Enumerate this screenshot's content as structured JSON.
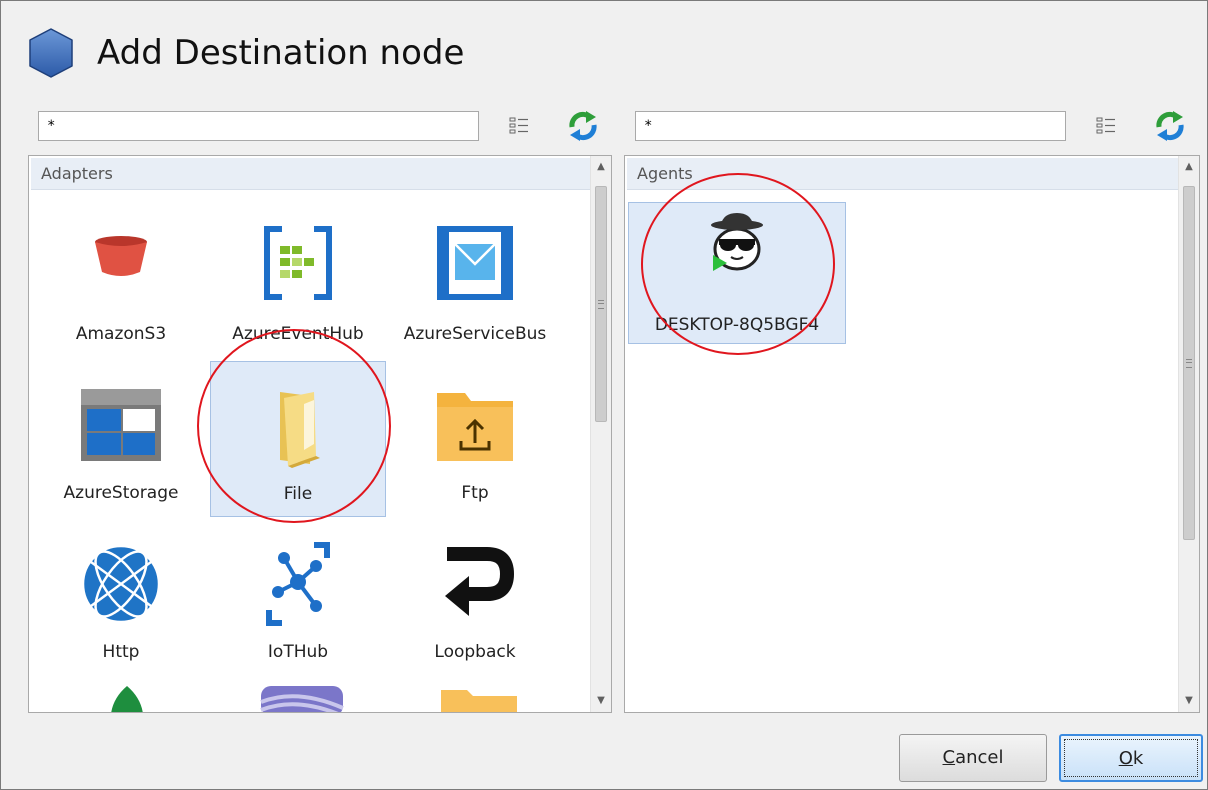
{
  "window": {
    "title": "Add Destination node"
  },
  "left": {
    "search_value": "*",
    "group_header": "Adapters",
    "items": [
      {
        "label": "AmazonS3",
        "icon": "amazon-s3-icon"
      },
      {
        "label": "AzureEventHub",
        "icon": "azure-event-hub-icon"
      },
      {
        "label": "AzureServiceBus",
        "icon": "azure-service-bus-icon"
      },
      {
        "label": "AzureStorage",
        "icon": "azure-storage-icon"
      },
      {
        "label": "File",
        "icon": "folder-icon",
        "selected": true
      },
      {
        "label": "Ftp",
        "icon": "ftp-upload-icon"
      },
      {
        "label": "Http",
        "icon": "globe-icon"
      },
      {
        "label": "IoTHub",
        "icon": "iot-hub-icon"
      },
      {
        "label": "Loopback",
        "icon": "loopback-arrow-icon"
      }
    ]
  },
  "right": {
    "search_value": "*",
    "group_header": "Agents",
    "items": [
      {
        "label": "DESKTOP-8Q5BGF4",
        "icon": "agent-spy-icon",
        "selected": true
      }
    ]
  },
  "buttons": {
    "cancel_prefix": "",
    "cancel_mnemonic": "C",
    "cancel_rest": "ancel",
    "ok_mnemonic": "O",
    "ok_rest": "k"
  },
  "colors": {
    "annotation": "#e0161e",
    "selection": "#dfeaf8",
    "azure_blue": "#0078d4",
    "aws_red": "#e05243"
  }
}
